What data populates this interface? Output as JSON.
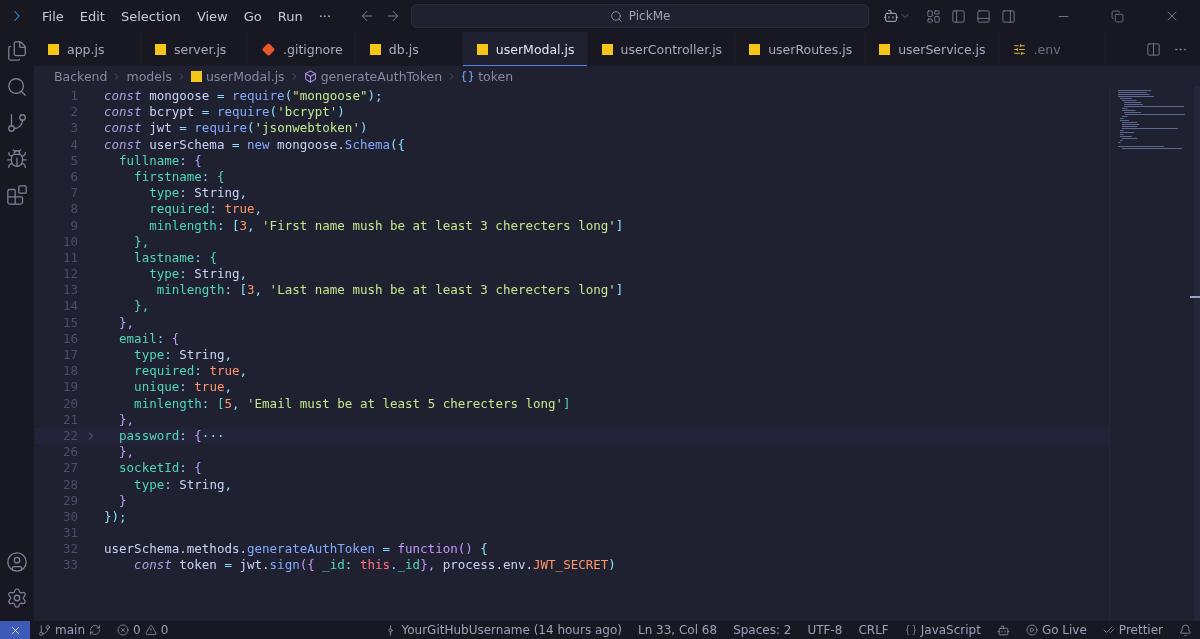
{
  "menu": [
    "File",
    "Edit",
    "Selection",
    "View",
    "Go",
    "Run",
    "···"
  ],
  "search": {
    "value": "PickMe"
  },
  "tabs": [
    {
      "label": "app.js",
      "kind": "js",
      "selected": false,
      "dimmed": false
    },
    {
      "label": "server.js",
      "kind": "js",
      "selected": false,
      "dimmed": false
    },
    {
      "label": ".gitignore",
      "kind": "git",
      "selected": false,
      "dimmed": false
    },
    {
      "label": "db.js",
      "kind": "js",
      "selected": false,
      "dimmed": false
    },
    {
      "label": "userModal.js",
      "kind": "js",
      "selected": true,
      "dimmed": false
    },
    {
      "label": "userController.js",
      "kind": "js",
      "selected": false,
      "dimmed": false
    },
    {
      "label": "userRoutes.js",
      "kind": "js",
      "selected": false,
      "dimmed": false
    },
    {
      "label": "userService.js",
      "kind": "js",
      "selected": false,
      "dimmed": false
    },
    {
      "label": ".env",
      "kind": "env",
      "selected": false,
      "dimmed": true
    }
  ],
  "breadcrumbs": [
    {
      "label": "Backend",
      "kind": "folder"
    },
    {
      "label": "models",
      "kind": "folder"
    },
    {
      "label": "userModal.js",
      "kind": "js"
    },
    {
      "label": "generateAuthToken",
      "kind": "method"
    },
    {
      "label": "token",
      "kind": "variable"
    }
  ],
  "lines": [
    {
      "n": "1",
      "folded": false,
      "tokens": [
        {
          "text": "const",
          "kind": "kw"
        },
        {
          "text": " mongoose ",
          "kind": "id"
        },
        {
          "text": "=",
          "kind": "op"
        },
        {
          "text": " require",
          "kind": "fn"
        },
        {
          "text": "(",
          "kind": "op"
        },
        {
          "text": "\"mongoose\"",
          "kind": "str"
        },
        {
          "text": ");",
          "kind": "op"
        }
      ]
    },
    {
      "n": "2",
      "folded": false,
      "tokens": [
        {
          "text": "const",
          "kind": "kw"
        },
        {
          "text": " bcrypt ",
          "kind": "id"
        },
        {
          "text": "=",
          "kind": "op"
        },
        {
          "text": " require",
          "kind": "fn"
        },
        {
          "text": "(",
          "kind": "op"
        },
        {
          "text": "'bcrypt'",
          "kind": "str"
        },
        {
          "text": ")",
          "kind": "op"
        }
      ]
    },
    {
      "n": "3",
      "folded": false,
      "tokens": [
        {
          "text": "const",
          "kind": "kw"
        },
        {
          "text": " jwt ",
          "kind": "id"
        },
        {
          "text": "=",
          "kind": "op"
        },
        {
          "text": " require",
          "kind": "fn"
        },
        {
          "text": "(",
          "kind": "op"
        },
        {
          "text": "'jsonwebtoken'",
          "kind": "str"
        },
        {
          "text": ")",
          "kind": "op"
        }
      ]
    },
    {
      "n": "4",
      "folded": false,
      "tokens": [
        {
          "text": "const",
          "kind": "kw"
        },
        {
          "text": " userSchema ",
          "kind": "id"
        },
        {
          "text": "=",
          "kind": "op"
        },
        {
          "text": " new",
          "kind": "fn"
        },
        {
          "text": " mongoose.",
          "kind": "id"
        },
        {
          "text": "Schema",
          "kind": "fn"
        },
        {
          "text": "({",
          "kind": "br"
        }
      ]
    },
    {
      "n": "5",
      "folded": false,
      "tokens": [
        {
          "text": "  fullname",
          "kind": "prop"
        },
        {
          "text": ": ",
          "kind": "op"
        },
        {
          "text": "{",
          "kind": "br2"
        }
      ]
    },
    {
      "n": "6",
      "folded": false,
      "tokens": [
        {
          "text": "    firstname",
          "kind": "prop"
        },
        {
          "text": ": ",
          "kind": "op"
        },
        {
          "text": "{",
          "kind": "br3"
        }
      ]
    },
    {
      "n": "7",
      "folded": false,
      "tokens": [
        {
          "text": "      type",
          "kind": "prop"
        },
        {
          "text": ": ",
          "kind": "op"
        },
        {
          "text": "String",
          "kind": "id"
        },
        {
          "text": ",",
          "kind": "op"
        }
      ]
    },
    {
      "n": "8",
      "folded": false,
      "tokens": [
        {
          "text": "      required",
          "kind": "prop"
        },
        {
          "text": ": ",
          "kind": "op"
        },
        {
          "text": "true",
          "kind": "num"
        },
        {
          "text": ",",
          "kind": "op"
        }
      ]
    },
    {
      "n": "9",
      "folded": false,
      "tokens": [
        {
          "text": "      minlength",
          "kind": "prop"
        },
        {
          "text": ": ",
          "kind": "op"
        },
        {
          "text": "[",
          "kind": "br"
        },
        {
          "text": "3",
          "kind": "num"
        },
        {
          "text": ", ",
          "kind": "op"
        },
        {
          "text": "'First name mush be at least 3 cherecters long'",
          "kind": "str"
        },
        {
          "text": "]",
          "kind": "br"
        }
      ]
    },
    {
      "n": "10",
      "folded": false,
      "tokens": [
        {
          "text": "    },",
          "kind": "br3"
        }
      ]
    },
    {
      "n": "11",
      "folded": false,
      "tokens": [
        {
          "text": "    lastname",
          "kind": "prop"
        },
        {
          "text": ": ",
          "kind": "op"
        },
        {
          "text": "{",
          "kind": "br3"
        }
      ]
    },
    {
      "n": "12",
      "folded": false,
      "tokens": [
        {
          "text": "      type",
          "kind": "prop"
        },
        {
          "text": ": ",
          "kind": "op"
        },
        {
          "text": "String",
          "kind": "id"
        },
        {
          "text": ",",
          "kind": "op"
        }
      ]
    },
    {
      "n": "13",
      "folded": false,
      "tokens": [
        {
          "text": "       minlength",
          "kind": "prop"
        },
        {
          "text": ": ",
          "kind": "op"
        },
        {
          "text": "[",
          "kind": "br"
        },
        {
          "text": "3",
          "kind": "num"
        },
        {
          "text": ", ",
          "kind": "op"
        },
        {
          "text": "'Last name mush be at least 3 cherecters long'",
          "kind": "str"
        },
        {
          "text": "]",
          "kind": "br"
        }
      ]
    },
    {
      "n": "14",
      "folded": false,
      "tokens": [
        {
          "text": "    },",
          "kind": "br3"
        }
      ]
    },
    {
      "n": "15",
      "folded": false,
      "tokens": [
        {
          "text": "  },",
          "kind": "br2"
        }
      ]
    },
    {
      "n": "16",
      "folded": false,
      "tokens": [
        {
          "text": "  email",
          "kind": "prop"
        },
        {
          "text": ": ",
          "kind": "op"
        },
        {
          "text": "{",
          "kind": "br2"
        }
      ]
    },
    {
      "n": "17",
      "folded": false,
      "tokens": [
        {
          "text": "    type",
          "kind": "prop"
        },
        {
          "text": ": ",
          "kind": "op"
        },
        {
          "text": "String",
          "kind": "id"
        },
        {
          "text": ",",
          "kind": "op"
        }
      ]
    },
    {
      "n": "18",
      "folded": false,
      "tokens": [
        {
          "text": "    required",
          "kind": "prop"
        },
        {
          "text": ": ",
          "kind": "op"
        },
        {
          "text": "true",
          "kind": "num"
        },
        {
          "text": ",",
          "kind": "op"
        }
      ]
    },
    {
      "n": "19",
      "folded": false,
      "tokens": [
        {
          "text": "    unique",
          "kind": "prop"
        },
        {
          "text": ": ",
          "kind": "op"
        },
        {
          "text": "true",
          "kind": "num"
        },
        {
          "text": ",",
          "kind": "op"
        }
      ]
    },
    {
      "n": "20",
      "folded": false,
      "tokens": [
        {
          "text": "    minlength",
          "kind": "prop"
        },
        {
          "text": ": ",
          "kind": "op"
        },
        {
          "text": "[",
          "kind": "br3"
        },
        {
          "text": "5",
          "kind": "num"
        },
        {
          "text": ", ",
          "kind": "op"
        },
        {
          "text": "'Email must be at least 5 cherecters long'",
          "kind": "str"
        },
        {
          "text": "]",
          "kind": "br3"
        }
      ]
    },
    {
      "n": "21",
      "folded": false,
      "tokens": [
        {
          "text": "  },",
          "kind": "br2"
        }
      ]
    },
    {
      "n": "22",
      "folded": true,
      "tokens": [
        {
          "text": "  password",
          "kind": "prop"
        },
        {
          "text": ": ",
          "kind": "op"
        },
        {
          "text": "{",
          "kind": "br2"
        },
        {
          "text": "···",
          "kind": "op"
        }
      ]
    },
    {
      "n": "26",
      "folded": false,
      "tokens": [
        {
          "text": "  },",
          "kind": "br2"
        }
      ]
    },
    {
      "n": "27",
      "folded": false,
      "tokens": [
        {
          "text": "  socketId",
          "kind": "prop"
        },
        {
          "text": ": ",
          "kind": "op"
        },
        {
          "text": "{",
          "kind": "br2"
        }
      ]
    },
    {
      "n": "28",
      "folded": false,
      "tokens": [
        {
          "text": "    type",
          "kind": "prop"
        },
        {
          "text": ": ",
          "kind": "op"
        },
        {
          "text": "String",
          "kind": "id"
        },
        {
          "text": ",",
          "kind": "op"
        }
      ]
    },
    {
      "n": "29",
      "folded": false,
      "tokens": [
        {
          "text": "  }",
          "kind": "br2"
        }
      ]
    },
    {
      "n": "30",
      "folded": false,
      "tokens": [
        {
          "text": "})",
          "kind": "br"
        },
        {
          "text": ";",
          "kind": "op"
        }
      ]
    },
    {
      "n": "31",
      "folded": false
    },
    {
      "n": "32",
      "folded": false,
      "tokens": [
        {
          "text": "userSchema.methods.",
          "kind": "id"
        },
        {
          "text": "generateAuthToken",
          "kind": "fn"
        },
        {
          "text": " = ",
          "kind": "op"
        },
        {
          "text": "function",
          "kind": "kw2"
        },
        {
          "text": "() ",
          "kind": "br2"
        },
        {
          "text": "{",
          "kind": "br"
        }
      ]
    },
    {
      "n": "33",
      "folded": false,
      "tokens": [
        {
          "text": "    const",
          "kind": "kw"
        },
        {
          "text": " token ",
          "kind": "id"
        },
        {
          "text": "=",
          "kind": "op"
        },
        {
          "text": " jwt.",
          "kind": "id"
        },
        {
          "text": "sign",
          "kind": "fn"
        },
        {
          "text": "({ ",
          "kind": "br2"
        },
        {
          "text": "_id",
          "kind": "prop"
        },
        {
          "text": ": ",
          "kind": "op"
        },
        {
          "text": "this",
          "kind": "this"
        },
        {
          "text": ".",
          "kind": "op"
        },
        {
          "text": "_id",
          "kind": "prop"
        },
        {
          "text": "}, ",
          "kind": "br2"
        },
        {
          "text": "process.env.",
          "kind": "id"
        },
        {
          "text": "JWT_SECRET",
          "kind": "num"
        },
        {
          "text": ")",
          "kind": "br"
        }
      ]
    }
  ],
  "status": {
    "branch": "main",
    "errors": "0",
    "warnings": "0",
    "blame": "YourGitHubUsername (14 hours ago)",
    "position": "Ln 33, Col 68",
    "spaces": "Spaces: 2",
    "encoding": "UTF-8",
    "eol": "CRLF",
    "language": "JavaScript",
    "golive": "Go Live",
    "prettier": "Prettier"
  }
}
